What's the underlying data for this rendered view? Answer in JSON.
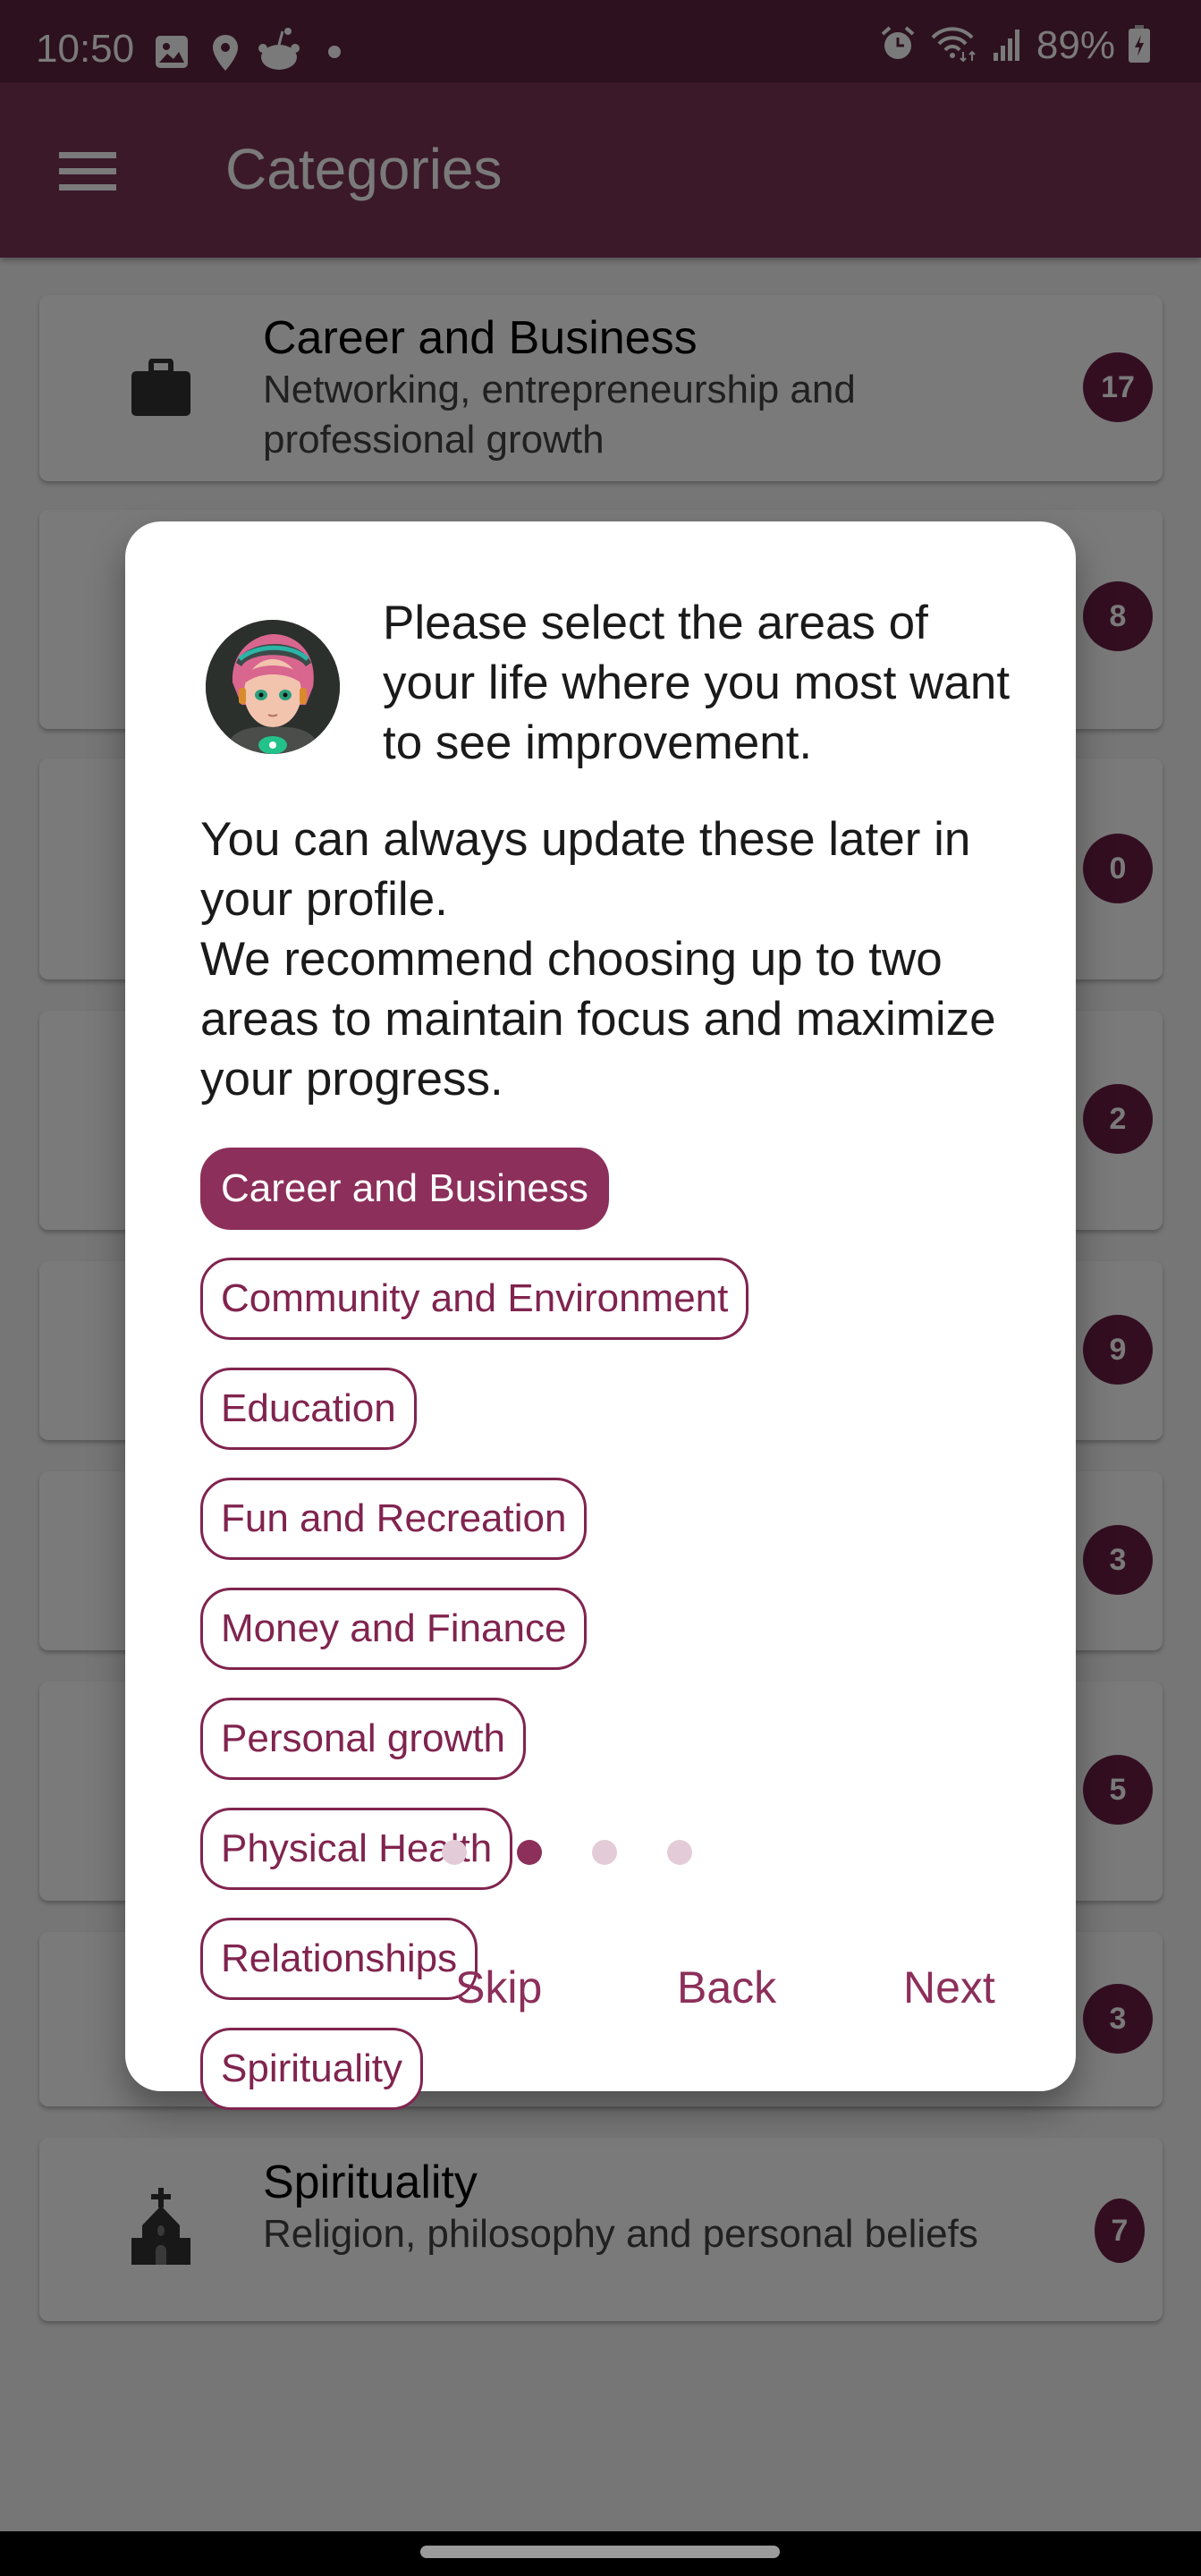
{
  "status_bar": {
    "time": "10:50",
    "left_icons": [
      "gallery-icon",
      "location-pin-icon",
      "reddit-icon",
      "notification-dot-icon"
    ],
    "right_icons": [
      "alarm-icon",
      "wifi-icon",
      "signal-icon",
      "battery-charging-icon"
    ],
    "battery": "89%"
  },
  "app_bar": {
    "title": "Categories",
    "menu_icon": "hamburger-menu-icon"
  },
  "categories": [
    {
      "title": "Career and Business",
      "subtitle": "Networking, entrepreneurship and professional growth",
      "count": "17",
      "icon": "briefcase-icon"
    },
    {
      "title": "Community and Environment",
      "subtitle": "",
      "count": "8",
      "icon": "community-icon"
    },
    {
      "title": "Education",
      "subtitle": "",
      "count": "0",
      "icon": "graduation-cap-icon"
    },
    {
      "title": "Fun and Recreation",
      "subtitle": "",
      "count": "2",
      "icon": "smiley-icon"
    },
    {
      "title": "Money and Finance",
      "subtitle": "",
      "count": "9",
      "icon": "dollar-icon"
    },
    {
      "title": "Personal growth",
      "subtitle": "",
      "count": "3",
      "icon": "book-icon"
    },
    {
      "title": "Physical Health",
      "subtitle": "",
      "count": "5",
      "icon": "tennis-racket-icon"
    },
    {
      "title": "Relationships",
      "subtitle": "",
      "count": "3",
      "icon": "family-icon"
    },
    {
      "title": "Spirituality",
      "subtitle": "Religion, philosophy and personal beliefs",
      "count": "7",
      "icon": "church-icon"
    }
  ],
  "dialog": {
    "heading": "Please select the areas of your life where you most want to see improvement.",
    "body_line1": "You can always update these later in your profile.",
    "body_line2": "We recommend choosing up to two areas to maintain focus and maximize your progress.",
    "chips": [
      {
        "label": "Career and Business",
        "selected": true
      },
      {
        "label": "Community and Environment",
        "selected": false
      },
      {
        "label": "Education",
        "selected": false
      },
      {
        "label": "Fun and Recreation",
        "selected": false
      },
      {
        "label": "Money and Finance",
        "selected": false
      },
      {
        "label": "Personal growth",
        "selected": false
      },
      {
        "label": "Physical Health",
        "selected": false
      },
      {
        "label": "Relationships",
        "selected": false
      },
      {
        "label": "Spirituality",
        "selected": false
      }
    ],
    "page_indicator": {
      "total": 4,
      "current": 2
    },
    "buttons": {
      "skip": "Skip",
      "back": "Back",
      "next": "Next"
    }
  },
  "colors": {
    "primary": "#8c2f5a",
    "app_bar": "#7b3657",
    "badge": "#6b1f45",
    "dot_inactive": "#e3ccd7"
  }
}
